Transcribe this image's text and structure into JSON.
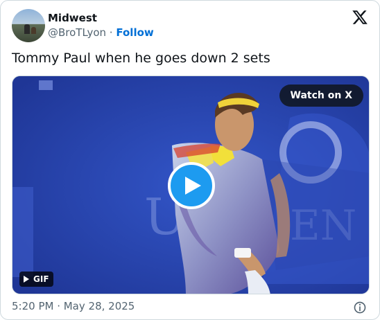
{
  "author": {
    "name": "Midwest",
    "handle": "@BroTLyon",
    "separator": "·",
    "follow_label": "Follow"
  },
  "tweet": {
    "text": "Tommy Paul when he goes down 2 sets"
  },
  "media": {
    "watch_label": "Watch on X",
    "gif_label": "GIF"
  },
  "footer": {
    "timestamp": "5:20 PM · May 28, 2025"
  },
  "icons": {
    "logo": "x-logo-icon",
    "play": "play-icon",
    "info": "info-icon"
  },
  "colors": {
    "follow": "#006fd6",
    "play_button": "#1d9bf0",
    "secondary_text": "#536471",
    "court_blue": "#2540a8"
  }
}
